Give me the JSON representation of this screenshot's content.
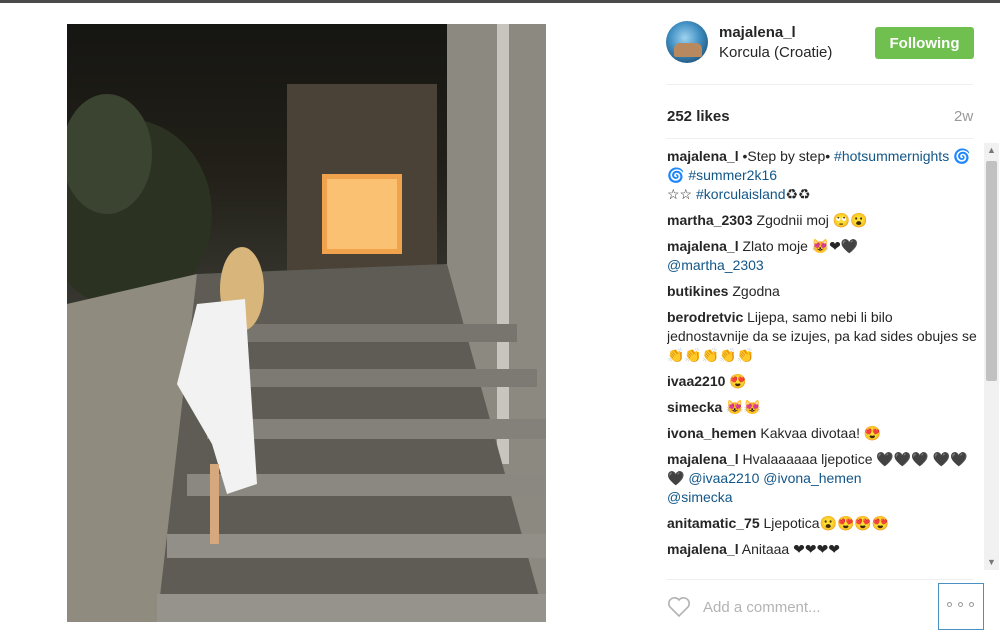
{
  "post": {
    "photo_alt": "",
    "username": "majalena_l",
    "location": "Korcula (Croatie)",
    "follow_label": "Following",
    "likes": "252 likes",
    "age": "2w",
    "comment_placeholder": "Add a comment...",
    "more_label": "∘∘∘"
  },
  "comments": [
    {
      "user": "majalena_l",
      "text": " •Step by step• ",
      "links": [
        "#hotsummernights",
        "#summer2k16",
        "#korculaisland"
      ],
      "rich": "caption"
    },
    {
      "user": "martha_2303",
      "text": "Zgodnii moj 🙄😮"
    },
    {
      "user": "majalena_l",
      "text": "Zlato moje 😻❤🖤",
      "mention": "@martha_2303"
    },
    {
      "user": "butikines",
      "text": "Zgodna"
    },
    {
      "user": "berodretvic",
      "text": "Lijepa, samo nebi li bilo jednostavnije da se izujes, pa kad sides obujes se 👏👏👏👏👏"
    },
    {
      "user": "ivaa2210",
      "text": "😍"
    },
    {
      "user": "simecka",
      "text": "😻😻"
    },
    {
      "user": "ivona_hemen",
      "text": "Kakvaa divotaa! 😍"
    },
    {
      "user": "majalena_l",
      "text": "Hvalaaaaaa ljepotice 🖤🖤🖤 🖤🖤🖤",
      "mentions": [
        "@ivaa2210",
        "@ivona_hemen",
        "@simecka"
      ]
    },
    {
      "user": "anitamatic_75",
      "text": "Ljepotica😮😍😍😍"
    },
    {
      "user": "majalena_l",
      "text": "Anitaaa ❤❤❤❤"
    }
  ],
  "caption_parts": {
    "emoji1": "🌀🌀",
    "emoji2": "☆☆",
    "emoji3": "♻♻"
  },
  "colors": {
    "follow_bg": "#70c050",
    "link": "#125688"
  }
}
